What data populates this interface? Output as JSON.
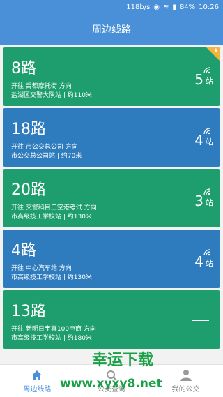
{
  "status_bar": {
    "speed": "118b/s",
    "battery": "84%",
    "time": "10:26"
  },
  "header": {
    "title": "周边线路"
  },
  "routes": [
    {
      "name": "8路",
      "direction": "开往  禹都摩托街  方向",
      "station": "盐湖区交警大队站 | 约110米",
      "count": "5",
      "unit": "站",
      "color": "#1e9e6f"
    },
    {
      "name": "18路",
      "direction": "开往  市公交总公司  方向",
      "station": "市公交总公司站 | 约70米",
      "count": "4",
      "unit": "站",
      "color": "#2e7bbd"
    },
    {
      "name": "20路",
      "direction": "开往  交警科目三空港考试  方向",
      "station": "市高级技工学校站 | 约130米",
      "count": "3",
      "unit": "站",
      "color": "#1e9e6f"
    },
    {
      "name": "4路",
      "direction": "开往  中心汽车站  方向",
      "station": "市高级技工学校站 | 约130米",
      "count": "4",
      "unit": "站",
      "color": "#2e7bbd"
    },
    {
      "name": "13路",
      "direction": "开往  新明日宝真100电商  方向",
      "station": "市高级技工学校站 | 约180米",
      "count": "",
      "unit": "",
      "color": "#1e9e6f"
    }
  ],
  "tab_bar": {
    "tabs": [
      {
        "label": "周边线路",
        "icon": "home-icon",
        "active": true
      },
      {
        "label": "公交查询",
        "icon": "search-icon",
        "active": false
      },
      {
        "label": "我的公交",
        "icon": "person-icon",
        "active": false
      }
    ]
  },
  "watermark": {
    "text": "幸运下载",
    "url": "www.xyxy8.net"
  },
  "colors": {
    "primary": "#4a90d9",
    "green": "#1e9e6f",
    "blue": "#2e7bbd",
    "star": "#f5b33c"
  }
}
